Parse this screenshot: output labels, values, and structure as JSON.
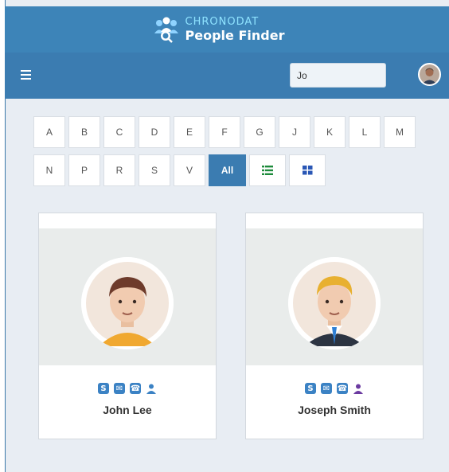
{
  "header": {
    "brand_top": "CHRONODAT",
    "brand_bottom": "People Finder"
  },
  "nav": {
    "search_value": "Jo",
    "menu_icon": "hamburger-icon",
    "avatar_icon": "user-avatar"
  },
  "letters": {
    "row1": [
      "A",
      "B",
      "C",
      "D",
      "E",
      "F",
      "G",
      "J",
      "K",
      "L",
      "M"
    ],
    "row2": [
      "N",
      "P",
      "R",
      "S",
      "V"
    ],
    "all_label": "All",
    "list_view_icon": "list-icon",
    "grid_view_icon": "grid-icon"
  },
  "people": [
    {
      "name": "John Lee",
      "icons": [
        "skype-icon",
        "email-icon",
        "phone-icon",
        "profile-icon"
      ],
      "profile_icon_color": "#3b82c4"
    },
    {
      "name": "Joseph Smith",
      "icons": [
        "skype-icon",
        "email-icon",
        "phone-icon",
        "profile-icon"
      ],
      "profile_icon_color": "#6b3aa0"
    }
  ],
  "colors": {
    "brand_bar": "#3d84b8",
    "nav_bar": "#3b7cb1",
    "accent": "#3b82c4",
    "list_icon": "#1d8a3b",
    "grid_icon": "#2a57b5"
  }
}
